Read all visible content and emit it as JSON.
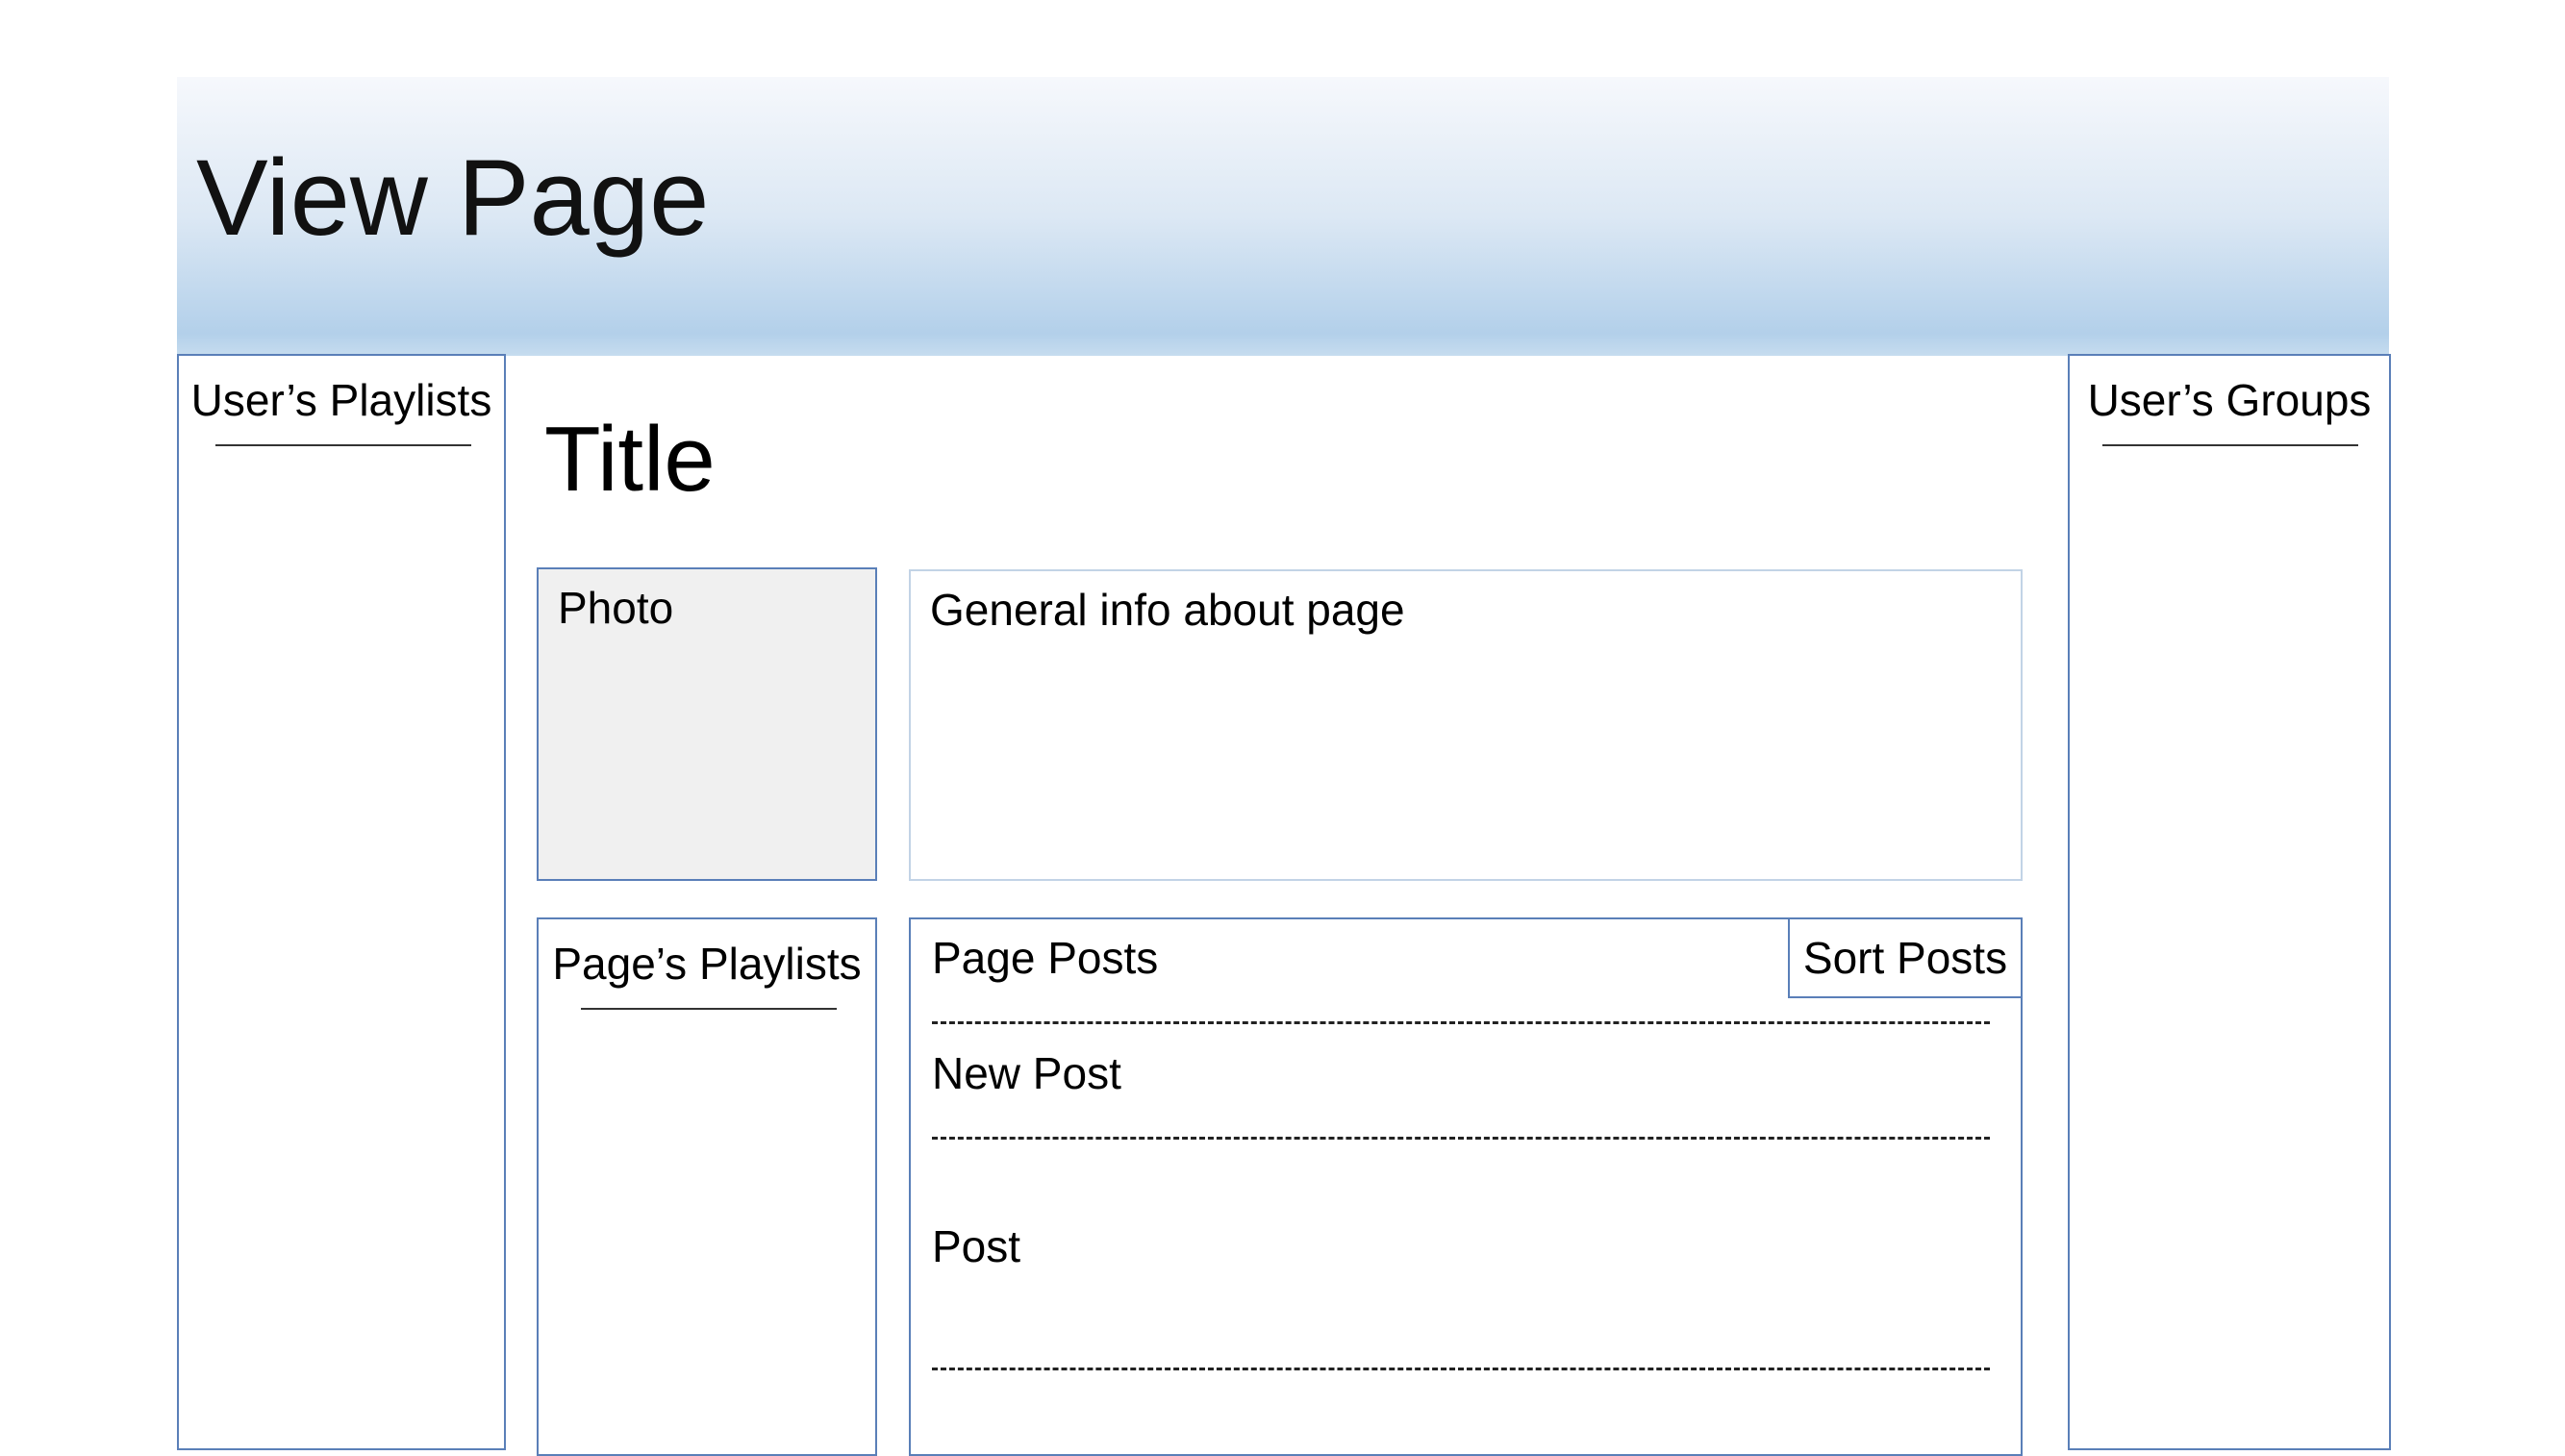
{
  "header": {
    "title": "View Page"
  },
  "left_sidebar": {
    "title": "User’s Playlists"
  },
  "right_sidebar": {
    "title": "User’s Groups"
  },
  "main": {
    "title": "Title",
    "photo_label": "Photo",
    "info_label": "General info about page",
    "playlists_title": "Page’s Playlists",
    "posts": {
      "title": "Page Posts",
      "sort_label": "Sort Posts",
      "new_post_label": "New Post",
      "post_label": "Post"
    }
  },
  "colors": {
    "border": "#5a7fb8",
    "header_gradient_light": "#f6f8fc",
    "header_gradient_dark": "#b3d0ea",
    "photo_fill": "#f0f0f0"
  }
}
